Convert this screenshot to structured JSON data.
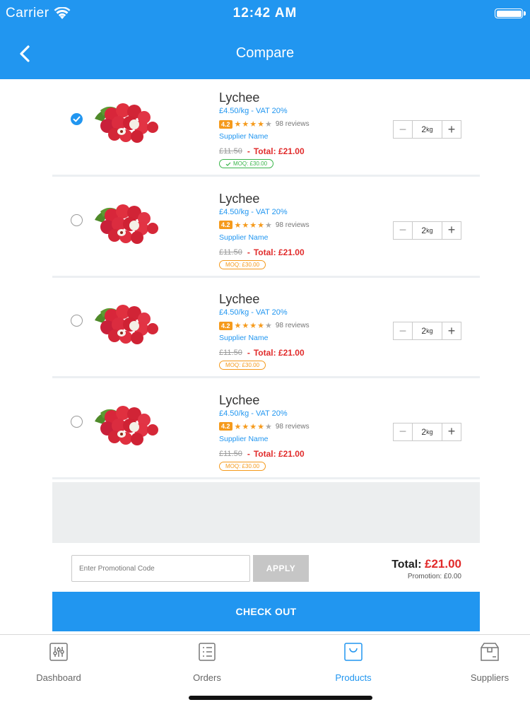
{
  "status_bar": {
    "carrier": "Carrier",
    "time": "12:42 AM"
  },
  "header": {
    "title": "Compare"
  },
  "products": [
    {
      "name": "Lychee",
      "price": "£4.50/kg - VAT 20%",
      "rating": "4.2",
      "reviews": "98 reviews",
      "supplier": "Supplier Name",
      "old_price": "£11.50",
      "dash": "-",
      "total": "Total: £21.00",
      "moq": "MOQ: £30.00",
      "moq_met": true,
      "selected": true,
      "qty": "2",
      "unit": "kg"
    },
    {
      "name": "Lychee",
      "price": "£4.50/kg - VAT 20%",
      "rating": "4.2",
      "reviews": "98 reviews",
      "supplier": "Supplier Name",
      "old_price": "£11.50",
      "dash": "-",
      "total": "Total: £21.00",
      "moq": "MOQ: £30.00",
      "moq_met": false,
      "selected": false,
      "qty": "2",
      "unit": "kg"
    },
    {
      "name": "Lychee",
      "price": "£4.50/kg - VAT 20%",
      "rating": "4.2",
      "reviews": "98 reviews",
      "supplier": "Supplier Name",
      "old_price": "£11.50",
      "dash": "-",
      "total": "Total: £21.00",
      "moq": "MOQ: £30.00",
      "moq_met": false,
      "selected": false,
      "qty": "2",
      "unit": "kg"
    },
    {
      "name": "Lychee",
      "price": "£4.50/kg - VAT 20%",
      "rating": "4.2",
      "reviews": "98 reviews",
      "supplier": "Supplier Name",
      "old_price": "£11.50",
      "dash": "-",
      "total": "Total: £21.00",
      "moq": "MOQ: £30.00",
      "moq_met": false,
      "selected": false,
      "qty": "2",
      "unit": "kg"
    }
  ],
  "promo": {
    "placeholder": "Enter Promotional Code",
    "value": "",
    "apply_label": "APPLY"
  },
  "summary": {
    "total_label": "Total:",
    "total_amount": "£21.00",
    "promotion": "Promotion: £0.00"
  },
  "checkout": {
    "label": "CHECK OUT"
  },
  "tabs": [
    {
      "label": "Dashboard",
      "icon": "sliders-icon",
      "active": false
    },
    {
      "label": "Orders",
      "icon": "list-icon",
      "active": false
    },
    {
      "label": "Products",
      "icon": "bag-icon",
      "active": true
    },
    {
      "label": "Suppliers",
      "icon": "box-icon",
      "active": false
    }
  ],
  "colors": {
    "accent": "#2196f0",
    "price_red": "#e12b2b",
    "rating_orange": "#f59a1c",
    "moq_ok": "#3ab54a"
  }
}
